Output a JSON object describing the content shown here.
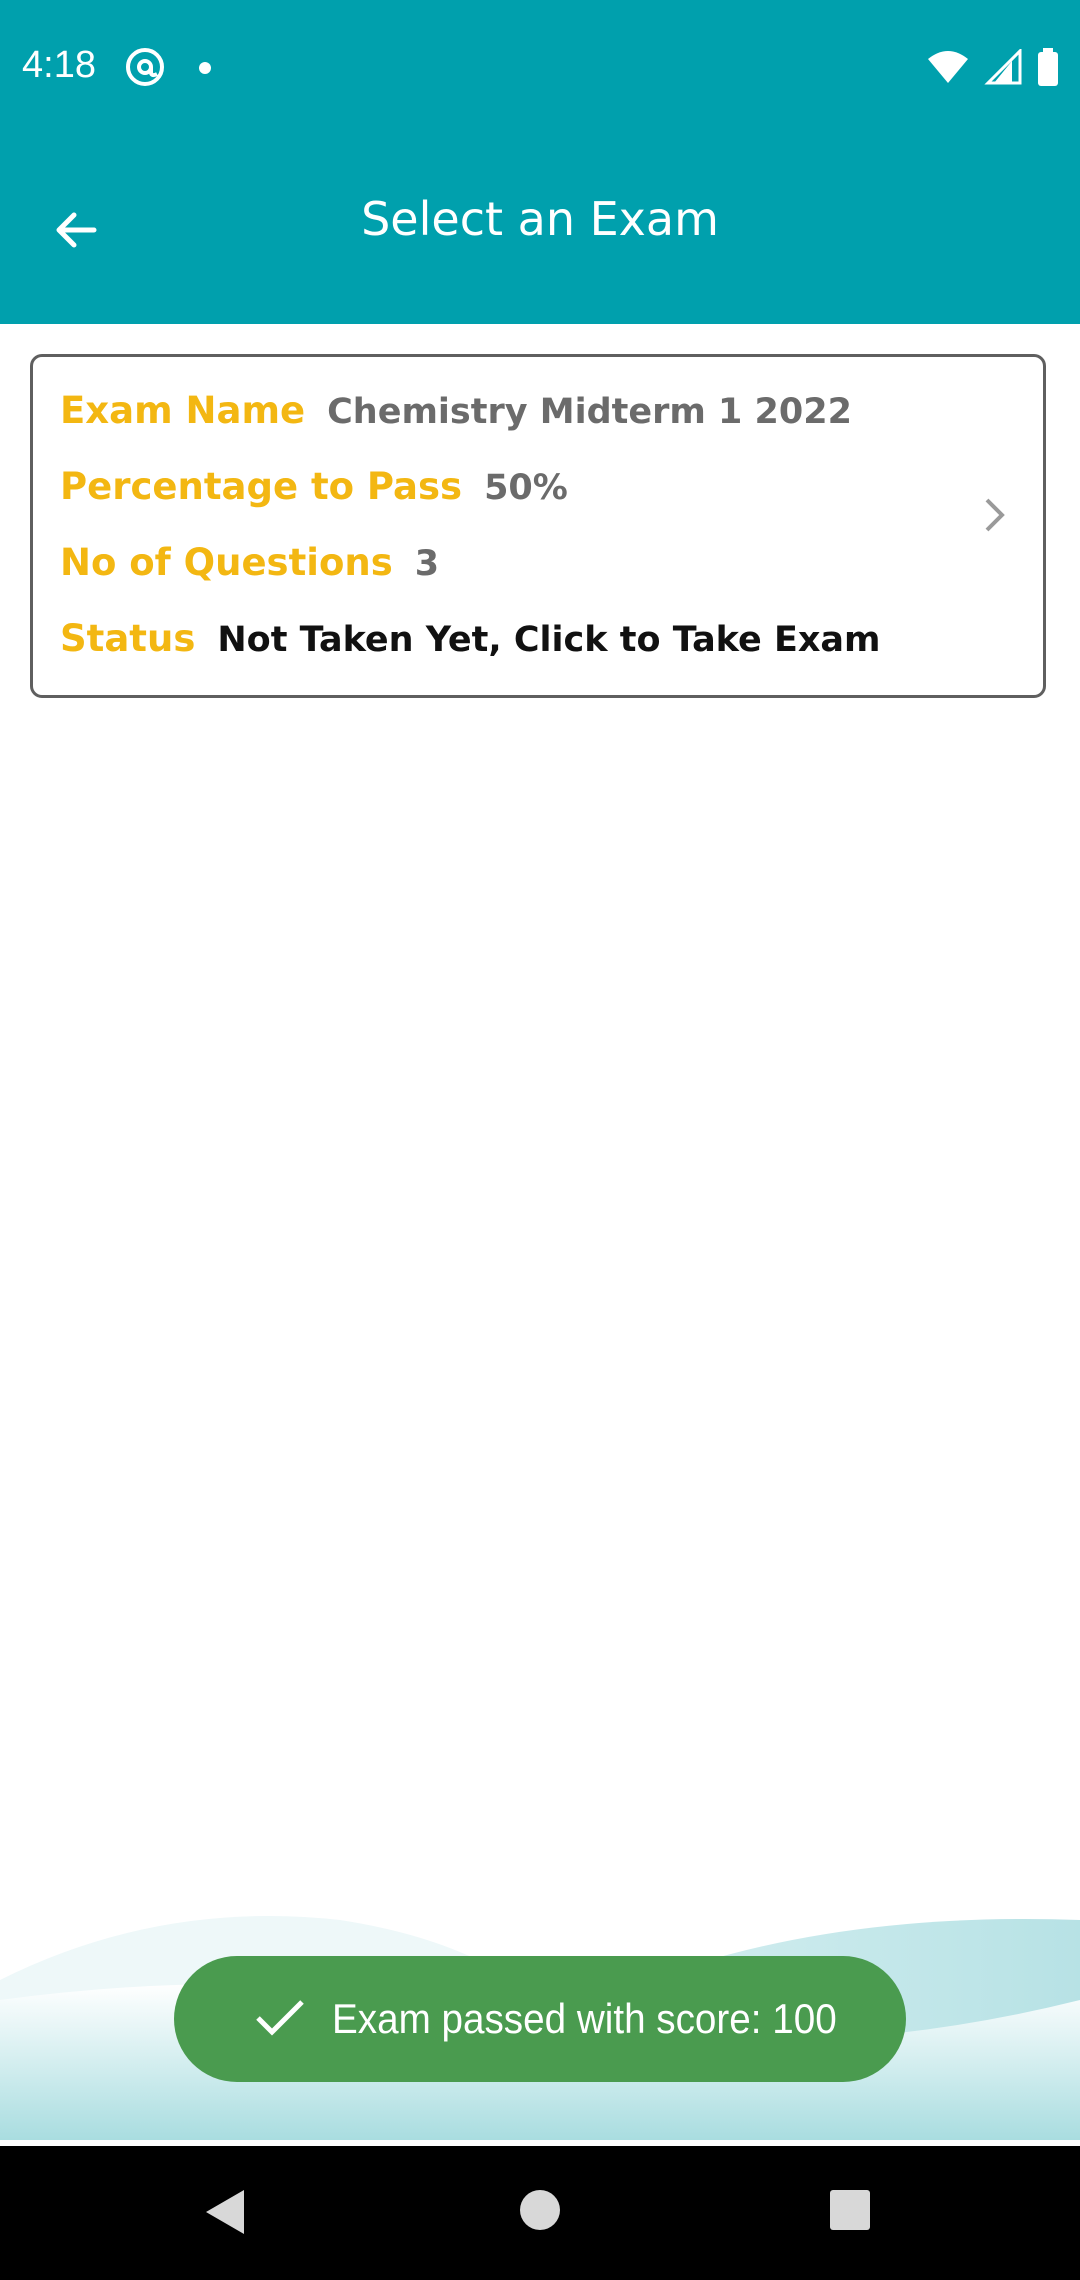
{
  "status_bar": {
    "time": "4:18",
    "left_icons": [
      "at-sign-icon",
      "dot-icon"
    ],
    "right_icons": [
      "wifi-icon",
      "signal-icon",
      "battery-icon"
    ]
  },
  "app_bar": {
    "back_icon": "arrow-back-icon",
    "title": "Select an Exam",
    "background_color": "#00a0ad"
  },
  "exam_card": {
    "exam_name_label": "Exam Name",
    "exam_name_value": "Chemistry Midterm 1 2022",
    "pass_label": "Percentage to Pass",
    "pass_value": "50%",
    "questions_label": "No of Questions",
    "questions_value": "3",
    "status_label": "Status",
    "status_value": "Not Taken Yet, Click to Take Exam",
    "label_color": "#f3b712",
    "chevron_icon": "chevron-right-icon"
  },
  "toast": {
    "icon": "check-icon",
    "message": "Exam passed with score: 100",
    "background_color": "#4a9b4f"
  },
  "nav_bar": {
    "icons": [
      "nav-back-icon",
      "nav-home-icon",
      "nav-recents-icon"
    ]
  }
}
